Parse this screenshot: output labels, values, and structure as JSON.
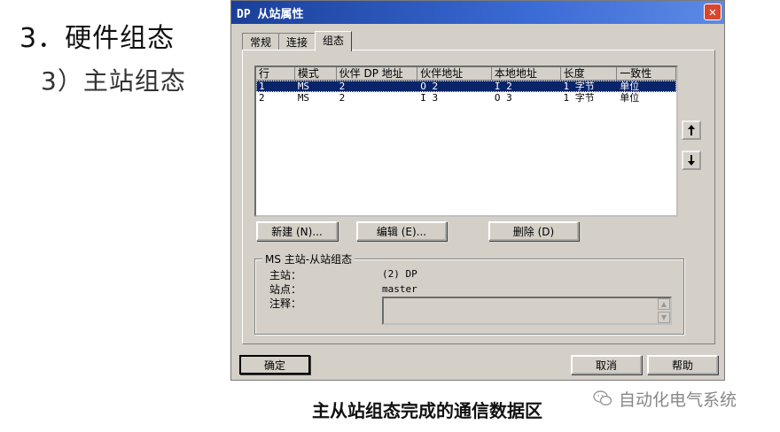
{
  "slide": {
    "heading": "3．硬件组态",
    "subheading": "3）主站组态",
    "caption": "主从站组态完成的通信数据区",
    "watermark": "自动化电气系统"
  },
  "dialog": {
    "title": "DP 从站属性",
    "tabs": [
      "常规",
      "连接",
      "组态"
    ],
    "active_tab": "组态",
    "table": {
      "headers": [
        "行",
        "模式",
        "伙伴 DP 地址",
        "伙伴地址",
        "本地地址",
        "长度",
        "一致性"
      ],
      "rows": [
        [
          "1",
          "MS",
          "2",
          "O 2",
          "I 2",
          "1 字节",
          "单位"
        ],
        [
          "2",
          "MS",
          "2",
          "I 3",
          "O 3",
          "1 字节",
          "单位"
        ]
      ],
      "selected_row": 0
    },
    "move_up_icon": "arrow-up-icon",
    "move_down_icon": "arrow-down-icon",
    "buttons": {
      "new": "新建 (N)...",
      "edit": "编辑 (E)...",
      "delete": "删除 (D)",
      "ok": "确定",
      "cancel": "取消",
      "help": "帮助"
    },
    "group": {
      "title": "MS 主站-从站组态",
      "master_label": "主站：",
      "master_value": "(2) DP",
      "station_label": "站点：",
      "station_value": "master",
      "comment_label": "注释：",
      "comment_value": ""
    }
  }
}
